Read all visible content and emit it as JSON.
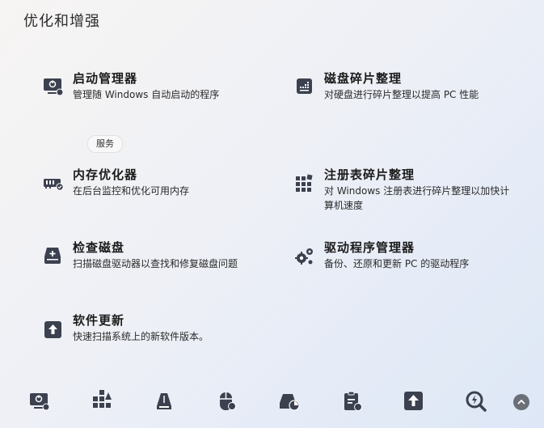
{
  "page": {
    "title": "优化和增强"
  },
  "tools": [
    {
      "id": "startup",
      "name": "启动管理器",
      "desc": "管理随 Windows 自动启动的程序",
      "icon": "startup-manager-icon"
    },
    {
      "id": "defrag",
      "name": "磁盘碎片整理",
      "desc": "对硬盘进行碎片整理以提高 PC 性能",
      "icon": "disk-defrag-icon"
    },
    {
      "id": "memory",
      "name": "内存优化器",
      "desc": "在后台监控和优化可用内存",
      "icon": "memory-optimizer-icon"
    },
    {
      "id": "registry",
      "name": "注册表碎片整理",
      "desc": "对 Windows 注册表进行碎片整理以加快计算机速度",
      "icon": "registry-defrag-icon"
    },
    {
      "id": "checkdisk",
      "name": "检查磁盘",
      "desc": "扫描磁盘驱动器以查找和修复磁盘问题",
      "icon": "check-disk-icon"
    },
    {
      "id": "driver",
      "name": "驱动程序管理器",
      "desc": "备份、还原和更新 PC 的驱动程序",
      "icon": "driver-manager-icon"
    },
    {
      "id": "update",
      "name": "软件更新",
      "desc": "快速扫描系统上的新软件版本。",
      "icon": "software-update-icon"
    }
  ],
  "tooltip": {
    "text": "服务"
  },
  "toolbar": {
    "items": [
      "startup-manager-icon",
      "apps-settings-icon",
      "disk-cleanup-icon",
      "mouse-settings-icon",
      "disk-analyzer-icon",
      "clipboard-settings-icon",
      "software-update-icon",
      "search-scan-icon"
    ]
  },
  "colors": {
    "icon": "#3c4150",
    "accent": "#5b6d8d"
  }
}
